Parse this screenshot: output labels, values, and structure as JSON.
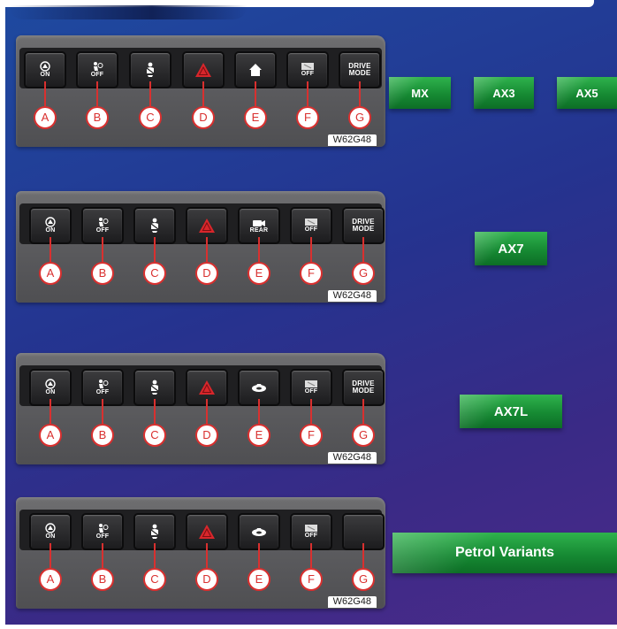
{
  "panels": [
    {
      "buttons": [
        {
          "letter": "A",
          "icon": "off-road-icon",
          "text": "ON"
        },
        {
          "letter": "B",
          "icon": "airbag-icon",
          "text": "OFF"
        },
        {
          "letter": "C",
          "icon": "seatbelt-icon",
          "text": ""
        },
        {
          "letter": "D",
          "icon": "hazard-icon",
          "text": ""
        },
        {
          "letter": "E",
          "icon": "home-icon",
          "text": ""
        },
        {
          "letter": "F",
          "icon": "auto-start-stop-icon",
          "text": "OFF"
        },
        {
          "letter": "G",
          "icon": "",
          "text": "DRIVE\nMODE"
        }
      ],
      "code": "W62G48"
    },
    {
      "buttons": [
        {
          "letter": "A",
          "icon": "off-road-icon",
          "text": "ON"
        },
        {
          "letter": "B",
          "icon": "airbag-icon",
          "text": "OFF"
        },
        {
          "letter": "C",
          "icon": "seatbelt-icon",
          "text": ""
        },
        {
          "letter": "D",
          "icon": "hazard-icon",
          "text": ""
        },
        {
          "letter": "E",
          "icon": "rear-camera-icon",
          "text": "REAR"
        },
        {
          "letter": "F",
          "icon": "auto-start-stop-icon",
          "text": "OFF"
        },
        {
          "letter": "G",
          "icon": "",
          "text": "DRIVE\nMODE"
        }
      ],
      "code": "W62G48"
    },
    {
      "buttons": [
        {
          "letter": "A",
          "icon": "off-road-icon",
          "text": "ON"
        },
        {
          "letter": "B",
          "icon": "airbag-icon",
          "text": "OFF"
        },
        {
          "letter": "C",
          "icon": "seatbelt-icon",
          "text": ""
        },
        {
          "letter": "D",
          "icon": "hazard-icon",
          "text": ""
        },
        {
          "letter": "E",
          "icon": "camera-360-icon",
          "text": ""
        },
        {
          "letter": "F",
          "icon": "auto-start-stop-icon",
          "text": "OFF"
        },
        {
          "letter": "G",
          "icon": "",
          "text": "DRIVE\nMODE"
        }
      ],
      "code": "W62G48"
    },
    {
      "buttons": [
        {
          "letter": "A",
          "icon": "off-road-icon",
          "text": "ON"
        },
        {
          "letter": "B",
          "icon": "airbag-icon",
          "text": "OFF"
        },
        {
          "letter": "C",
          "icon": "seatbelt-icon",
          "text": ""
        },
        {
          "letter": "D",
          "icon": "hazard-icon",
          "text": ""
        },
        {
          "letter": "E",
          "icon": "camera-360-icon",
          "text": ""
        },
        {
          "letter": "F",
          "icon": "auto-start-stop-icon",
          "text": "OFF"
        },
        {
          "letter": "G",
          "icon": "",
          "text": ""
        }
      ],
      "code": "W62G48"
    }
  ],
  "tags": {
    "mx": "MX",
    "ax3": "AX3",
    "ax5": "AX5",
    "ax7": "AX7",
    "ax7l": "AX7L",
    "petrol": "Petrol Variants"
  },
  "colors": {
    "tag_green": "#168a33",
    "callout_red": "#d9302f",
    "hazard_red": "#d8262b"
  }
}
